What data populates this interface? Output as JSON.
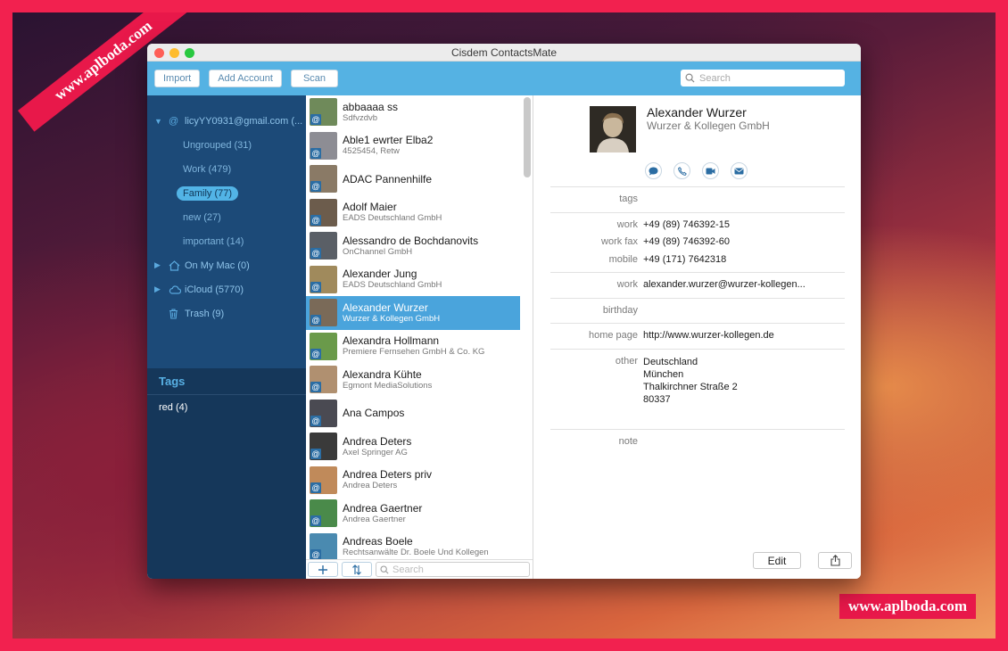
{
  "app": {
    "title": "Cisdem ContactsMate"
  },
  "watermark": {
    "ribbon": "www.aplboda.com",
    "badge": "www.aplboda.com"
  },
  "toolbar": {
    "import_label": "Import",
    "add_account_label": "Add Account",
    "scan_label": "Scan",
    "search_placeholder": "Search"
  },
  "sidebar": {
    "account_email": "licyYY0931@gmail.com (...",
    "groups": [
      {
        "label": "Ungrouped (31)"
      },
      {
        "label": "Work (479)"
      },
      {
        "label": "Family (77)",
        "selected": true
      },
      {
        "label": "new (27)"
      },
      {
        "label": "important (14)"
      }
    ],
    "sources": [
      {
        "label": "On My Mac (0)",
        "icon": "house-icon"
      },
      {
        "label": "iCloud (5770)",
        "icon": "cloud-icon"
      },
      {
        "label": "Trash (9)",
        "icon": "trash-icon"
      }
    ],
    "tags_title": "Tags",
    "tags": [
      {
        "label": "red (4)"
      }
    ]
  },
  "contacts": [
    {
      "name": "abbaaaa ss",
      "sub": "Sdfvzdvb",
      "color": "#6f8a5a"
    },
    {
      "name": "Able1 ewrter Elba2",
      "sub": "4525454, Retw",
      "color": "#8d8d94"
    },
    {
      "name": "ADAC Pannenhilfe",
      "sub": "",
      "color": "#8a7a66"
    },
    {
      "name": "Adolf Maier",
      "sub": "EADS Deutschland GmbH",
      "color": "#6c5c4c"
    },
    {
      "name": "Alessandro de Bochdanovits",
      "sub": "OnChannel GmbH",
      "color": "#5a5f66"
    },
    {
      "name": "Alexander Jung",
      "sub": "EADS Deutschland GmbH",
      "color": "#a08a5c"
    },
    {
      "name": "Alexander Wurzer",
      "sub": "Wurzer & Kollegen GmbH",
      "color": "#7a6a58",
      "selected": true
    },
    {
      "name": "Alexandra Hollmann",
      "sub": "Premiere Fernsehen GmbH & Co. KG",
      "color": "#6a9a4a"
    },
    {
      "name": "Alexandra Kühte",
      "sub": "Egmont MediaSolutions",
      "color": "#b09070"
    },
    {
      "name": "Ana Campos",
      "sub": "",
      "color": "#4a4a52"
    },
    {
      "name": "Andrea Deters",
      "sub": "Axel Springer AG",
      "color": "#3a3a3a"
    },
    {
      "name": "Andrea Deters priv",
      "sub": "Andrea Deters",
      "color": "#c08a5a"
    },
    {
      "name": "Andrea Gaertner",
      "sub": "Andrea Gaertner",
      "color": "#4a8a4a"
    },
    {
      "name": "Andreas Boele",
      "sub": "Rechtsanwälte Dr. Boele Und Kollegen",
      "color": "#4a8ab0"
    }
  ],
  "list_search_placeholder": "Search",
  "detail": {
    "name": "Alexander Wurzer",
    "company": "Wurzer & Kollegen GmbH",
    "tags_label": "tags",
    "phones": [
      {
        "label": "work",
        "value": "+49 (89) 746392-15"
      },
      {
        "label": "work fax",
        "value": "+49 (89) 746392-60"
      },
      {
        "label": "mobile",
        "value": "+49 (171) 7642318"
      }
    ],
    "email": {
      "label": "work",
      "value": "alexander.wurzer@wurzer-kollegen..."
    },
    "birthday_label": "birthday",
    "homepage": {
      "label": "home page",
      "value": "http://www.wurzer-kollegen.de"
    },
    "address": {
      "label": "other",
      "lines": [
        "Deutschland",
        "München",
        "Thalkirchner Straße 2",
        "80337"
      ]
    },
    "note_label": "note",
    "edit_label": "Edit"
  },
  "colors": {
    "toolbar": "#55b2e3",
    "sidebar_top": "#1c4a78",
    "sidebar_bottom": "#15375a",
    "selection": "#4aa4dc",
    "accent": "#2b6da3"
  }
}
